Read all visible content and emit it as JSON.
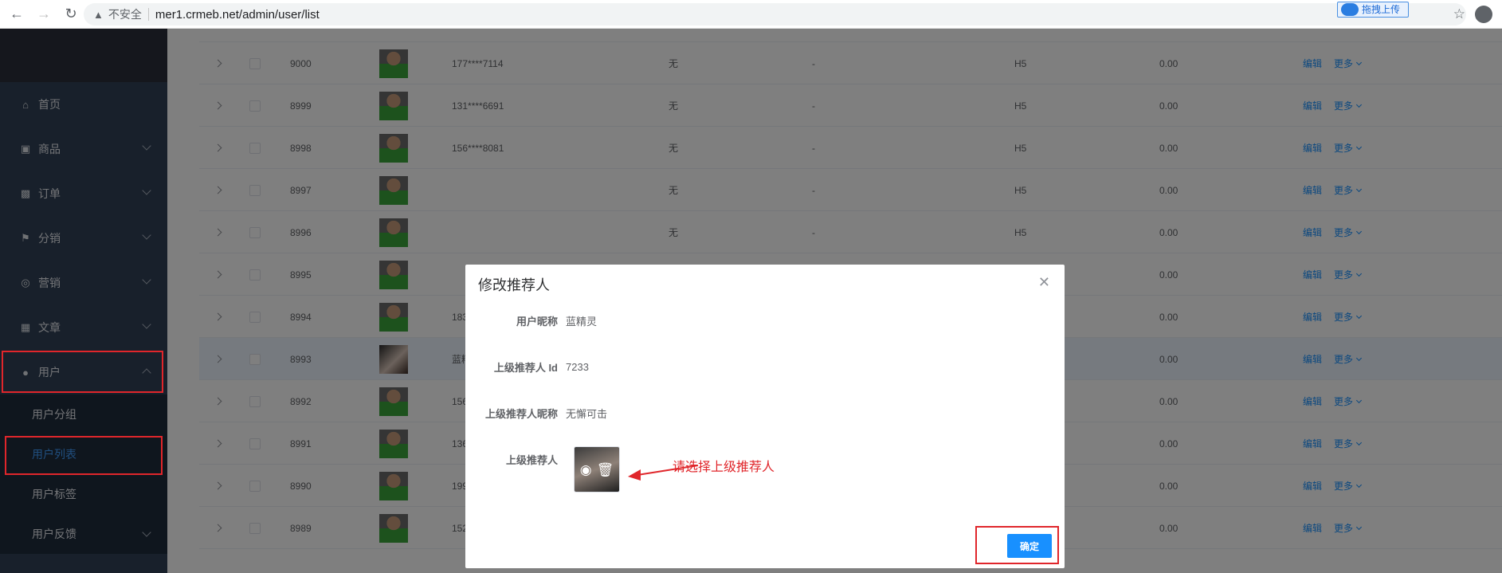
{
  "browser": {
    "insecure_label": "不安全",
    "url": "mer1.crmeb.net/admin/user/list",
    "upload_label": "拖拽上传"
  },
  "sidebar": {
    "items": [
      {
        "label": "首页",
        "icon": "home-icon"
      },
      {
        "label": "商品",
        "icon": "bag-icon"
      },
      {
        "label": "订单",
        "icon": "briefcase-icon"
      },
      {
        "label": "分销",
        "icon": "flag-icon"
      },
      {
        "label": "营销",
        "icon": "target-icon"
      },
      {
        "label": "文章",
        "icon": "book-icon"
      },
      {
        "label": "用户",
        "icon": "user-icon"
      }
    ],
    "submenu": [
      {
        "label": "用户分组"
      },
      {
        "label": "用户列表"
      },
      {
        "label": "用户标签"
      },
      {
        "label": "用户反馈"
      }
    ]
  },
  "table": {
    "edit_label": "编辑",
    "more_label": "更多",
    "rows": [
      {
        "id": "9000",
        "phone": "177****7114",
        "tag": "无",
        "dash": "-",
        "channel": "H5",
        "money": "0.00"
      },
      {
        "id": "8999",
        "phone": "131****6691",
        "tag": "无",
        "dash": "-",
        "channel": "H5",
        "money": "0.00"
      },
      {
        "id": "8998",
        "phone": "156****8081",
        "tag": "无",
        "dash": "-",
        "channel": "H5",
        "money": "0.00"
      },
      {
        "id": "8997",
        "phone": "",
        "tag": "无",
        "dash": "-",
        "channel": "H5",
        "money": "0.00"
      },
      {
        "id": "8996",
        "phone": "",
        "tag": "无",
        "dash": "-",
        "channel": "H5",
        "money": "0.00"
      },
      {
        "id": "8995",
        "phone": "",
        "tag": "",
        "dash": "",
        "channel": "",
        "money": "0.00"
      },
      {
        "id": "8994",
        "phone": "183",
        "tag": "",
        "dash": "",
        "channel": "",
        "money": "0.00"
      },
      {
        "id": "8993",
        "phone": "蓝精",
        "tag": "",
        "dash": "",
        "channel": "",
        "money": "0.00"
      },
      {
        "id": "8992",
        "phone": "156",
        "tag": "",
        "dash": "",
        "channel": "",
        "money": "0.00"
      },
      {
        "id": "8991",
        "phone": "136",
        "tag": "",
        "dash": "",
        "channel": "",
        "money": "0.00"
      },
      {
        "id": "8990",
        "phone": "199",
        "tag": "",
        "dash": "",
        "channel": "",
        "money": "0.00"
      },
      {
        "id": "8989",
        "phone": "152",
        "tag": "",
        "dash": "",
        "channel": "",
        "money": "0.00"
      }
    ]
  },
  "modal": {
    "title": "修改推荐人",
    "nickname_label": "用户昵称",
    "nickname_value": "蓝精灵",
    "referrer_id_label": "上级推荐人 Id",
    "referrer_id_value": "7233",
    "referrer_nick_label": "上级推荐人昵称",
    "referrer_nick_value": "无懈可击",
    "referrer_label": "上级推荐人",
    "annotation": "请选择上级推荐人",
    "confirm_label": "确定"
  }
}
